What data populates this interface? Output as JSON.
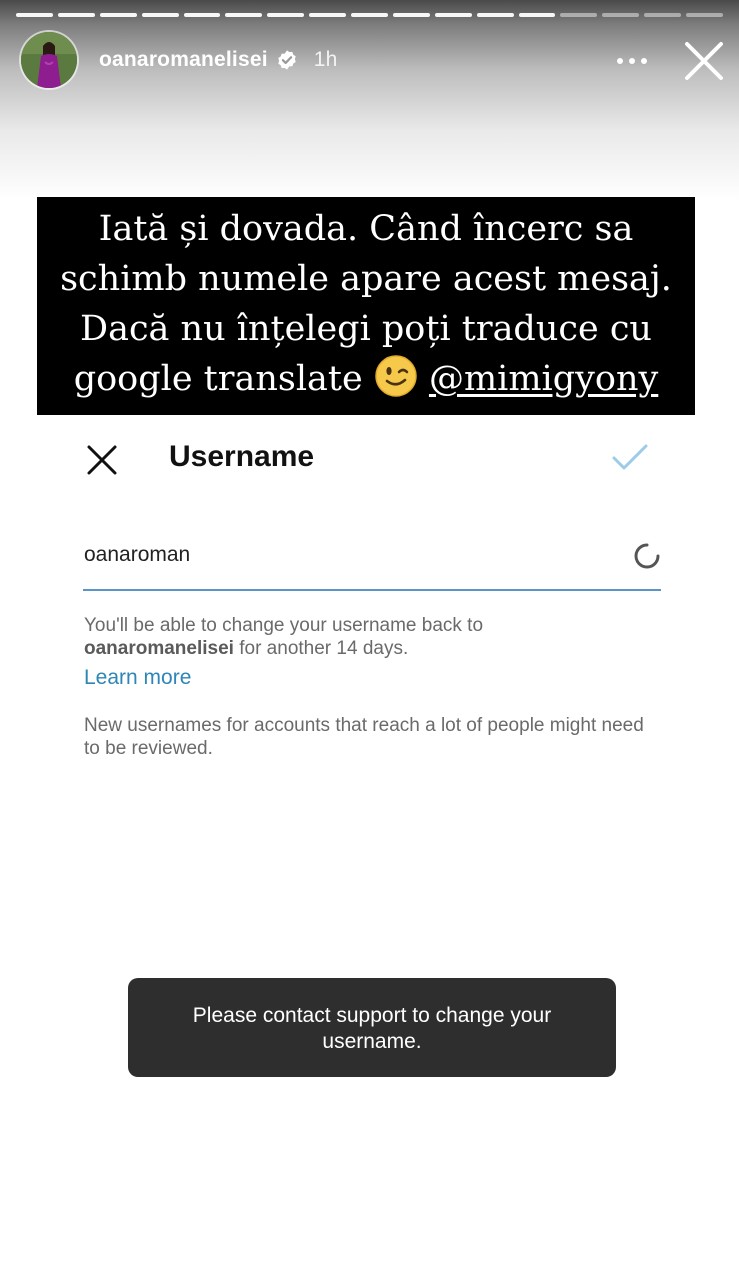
{
  "story": {
    "segments": 17,
    "active_segment": 13,
    "username": "oanaromanelisei",
    "time": "1h",
    "more_icon": "more-horizontal-icon",
    "close_icon": "close-icon",
    "verified_icon": "verified-badge-icon",
    "caption": {
      "line1": "Iată și dovada. Când încerc sa",
      "line2": "schimb numele apare acest mesaj.",
      "line3": "Dacă nu înțelegi poți traduce cu",
      "line4_prefix": "google translate ",
      "emoji": "winking-face-emoji",
      "line4_mention": "@mimigyony"
    }
  },
  "screen": {
    "close_icon": "close-icon",
    "title": "Username",
    "confirm_icon": "checkmark-icon",
    "field_value": "oanaroman",
    "spinner_icon": "loading-spinner-icon",
    "helper_prefix": "You'll be able to change your username back to",
    "helper_username": "oanaromanelisei",
    "helper_suffix": " for another 14 days.",
    "learn_more": "Learn more",
    "note": "New usernames for accounts that reach a lot of people might need to be reviewed.",
    "toast": "Please contact support to change your username."
  },
  "colors": {
    "accent_link": "#2d86b6",
    "field_underline": "#5a95c6",
    "checkmark": "#9ccce8",
    "toast_bg": "#2e2e2e"
  }
}
